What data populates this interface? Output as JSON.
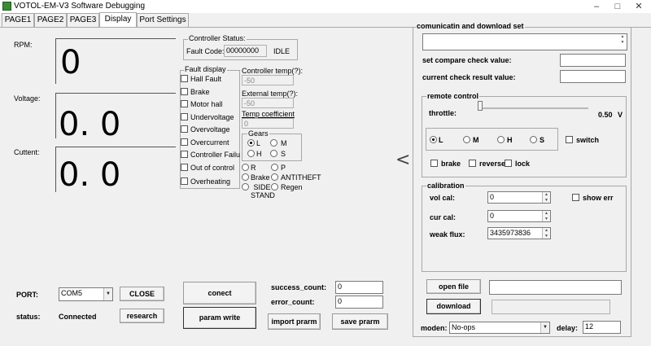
{
  "window": {
    "title": "VOTOL-EM-V3 Software Debugging",
    "minimize": "–",
    "maximize": "□",
    "close": "✕"
  },
  "tabs": [
    "PAGE1",
    "PAGE2",
    "PAGE3",
    "Display",
    "Port Settings"
  ],
  "gauges": {
    "rpm": {
      "label": "RPM:",
      "value": "0"
    },
    "voltage": {
      "label": "Voltage:",
      "value": "0. 0"
    },
    "current": {
      "label": "Cuttent:",
      "value": "0. 0"
    }
  },
  "controller_status": {
    "title": "Controller Status:",
    "fault_code_label": "Fault Code:",
    "fault_code": "00000000",
    "state": "IDLE"
  },
  "fault_display": {
    "title": "Fault display",
    "items": [
      "Hall Fault",
      "Brake",
      "Motor hall",
      "Undervoltage",
      "Overvoltage",
      "Overcurrent",
      "Controller Failure",
      "Out of control",
      "Overheating"
    ]
  },
  "temps": {
    "controller_label": "Controller temp(?):",
    "controller_value": "-50",
    "external_label": "External temp(?):",
    "external_value": "-50",
    "coeff_label": "Temp coefficient",
    "coeff_value": "0"
  },
  "gears": {
    "title": "Gears",
    "options": [
      "L",
      "M",
      "H",
      "S"
    ],
    "selected": "L"
  },
  "states": [
    "R",
    "P",
    "Brake",
    "ANTITHEFT",
    "SIDE STAND",
    "Regen"
  ],
  "port": {
    "label": "PORT:",
    "value": "COM5",
    "close_button": "CLOSE",
    "status_label": "status:",
    "status_value": "Connected",
    "research_button": "research"
  },
  "connect_button": "conect",
  "param_write_button": "param write",
  "counts": {
    "success_label": "success_count:",
    "success_value": "0",
    "error_label": "error_count:",
    "error_value": "0"
  },
  "import_button": "import prarm",
  "save_button": "save prarm",
  "collapse_arrow": "<",
  "comm": {
    "title": "comunicatin and download set",
    "compare_label": "set compare check value:",
    "compare_value": "",
    "current_check_label": "current check result value:",
    "current_check_value": ""
  },
  "remote": {
    "title": "remote control",
    "throttle_label": "throttle:",
    "throttle_value": "0.50",
    "throttle_unit": "V",
    "throttle_fraction": 0.0,
    "modes": [
      "L",
      "M",
      "H",
      "S"
    ],
    "mode_selected": "L",
    "switch_label": "switch",
    "brake_label": "brake",
    "reverse_label": "reverse",
    "lock_label": "lock"
  },
  "calibration": {
    "title": "calibration",
    "vol_label": "vol cal:",
    "vol_value": "0",
    "cur_label": "cur cal:",
    "cur_value": "0",
    "weak_label": "weak flux:",
    "weak_value": "3435973836",
    "show_err_label": "show err"
  },
  "download": {
    "open_file_button": "open file",
    "file_path": "",
    "download_button": "download",
    "progress": "",
    "moden_label": "moden:",
    "moden_value": "No-ops",
    "delay_label": "delay:",
    "delay_value": "12"
  },
  "colors": {
    "background": "#f0f0f0",
    "input_bg": "#ffffff",
    "border": "#a8a8a8"
  }
}
